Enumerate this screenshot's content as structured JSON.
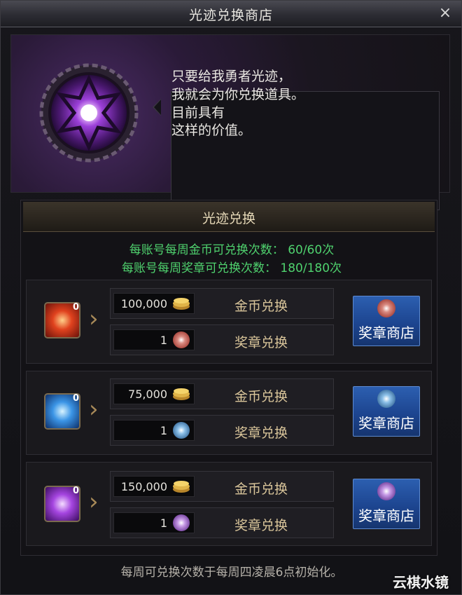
{
  "window": {
    "title": "光迹兑换商店",
    "close_icon": "close-icon",
    "close_glyph": "×"
  },
  "npc": {
    "emblem_icon": "light-trace-emblem-icon",
    "lines": [
      "只要给我勇者光迹，",
      "我就会为你兑换道具。",
      "目前具有",
      "这样的价值。"
    ]
  },
  "exchange": {
    "header": "光迹兑换",
    "gold_limit": "每账号每周金币可兑换次数： 60/60次",
    "medal_limit": "每账号每周奖章可兑换次数： 180/180次",
    "rows": [
      {
        "item_color": "#c62a18",
        "item_count": "0",
        "gold_price": "100,000",
        "gold_label": "金币兑换",
        "medal_price": "1",
        "medal_label": "奖章兑换",
        "medal_color": "#c0392b",
        "shop_label": "奖章商店"
      },
      {
        "item_color": "#2c7fd6",
        "item_count": "0",
        "gold_price": "75,000",
        "gold_label": "金币兑换",
        "medal_price": "1",
        "medal_label": "奖章兑换",
        "medal_color": "#3b7fc4",
        "shop_label": "奖章商店"
      },
      {
        "item_color": "#8b2fd0",
        "item_count": "0",
        "gold_price": "150,000",
        "gold_label": "金币兑换",
        "medal_price": "1",
        "medal_label": "奖章兑换",
        "medal_color": "#8e44c9",
        "shop_label": "奖章商店"
      }
    ]
  },
  "footer": "每周可兑换次数于每周四凌晨6点初始化。",
  "watermark": "云棋水镜"
}
